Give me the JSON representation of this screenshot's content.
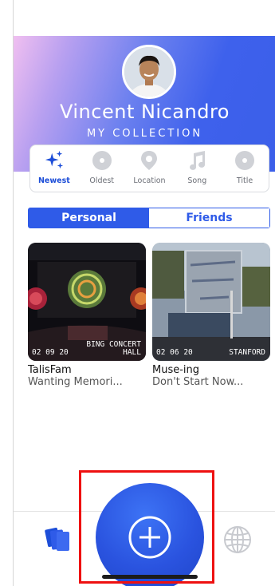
{
  "profile": {
    "name": "Vincent Nicandro",
    "subtitle": "MY COLLECTION"
  },
  "sort_options": [
    {
      "label": "Newest",
      "icon": "sparkles-icon",
      "active": true
    },
    {
      "label": "Oldest",
      "icon": "disc-icon",
      "active": false
    },
    {
      "label": "Location",
      "icon": "location-pin-icon",
      "active": false
    },
    {
      "label": "Song",
      "icon": "music-note-icon",
      "active": false
    },
    {
      "label": "Title",
      "icon": "disc-icon",
      "active": false
    }
  ],
  "segments": {
    "personal": "Personal",
    "friends": "Friends"
  },
  "memories": [
    {
      "date": "02 09 20",
      "place_line1": "BING CONCERT",
      "place_line2": "HALL",
      "title": "TalisFam",
      "song": "Wanting Memori..."
    },
    {
      "date": "02 06 20",
      "place_line1": "STANFORD",
      "place_line2": "",
      "title": "Muse-ing",
      "song": "Don't Start Now..."
    }
  ],
  "colors": {
    "accent": "#2f5be8",
    "highlight": "#e11111"
  }
}
